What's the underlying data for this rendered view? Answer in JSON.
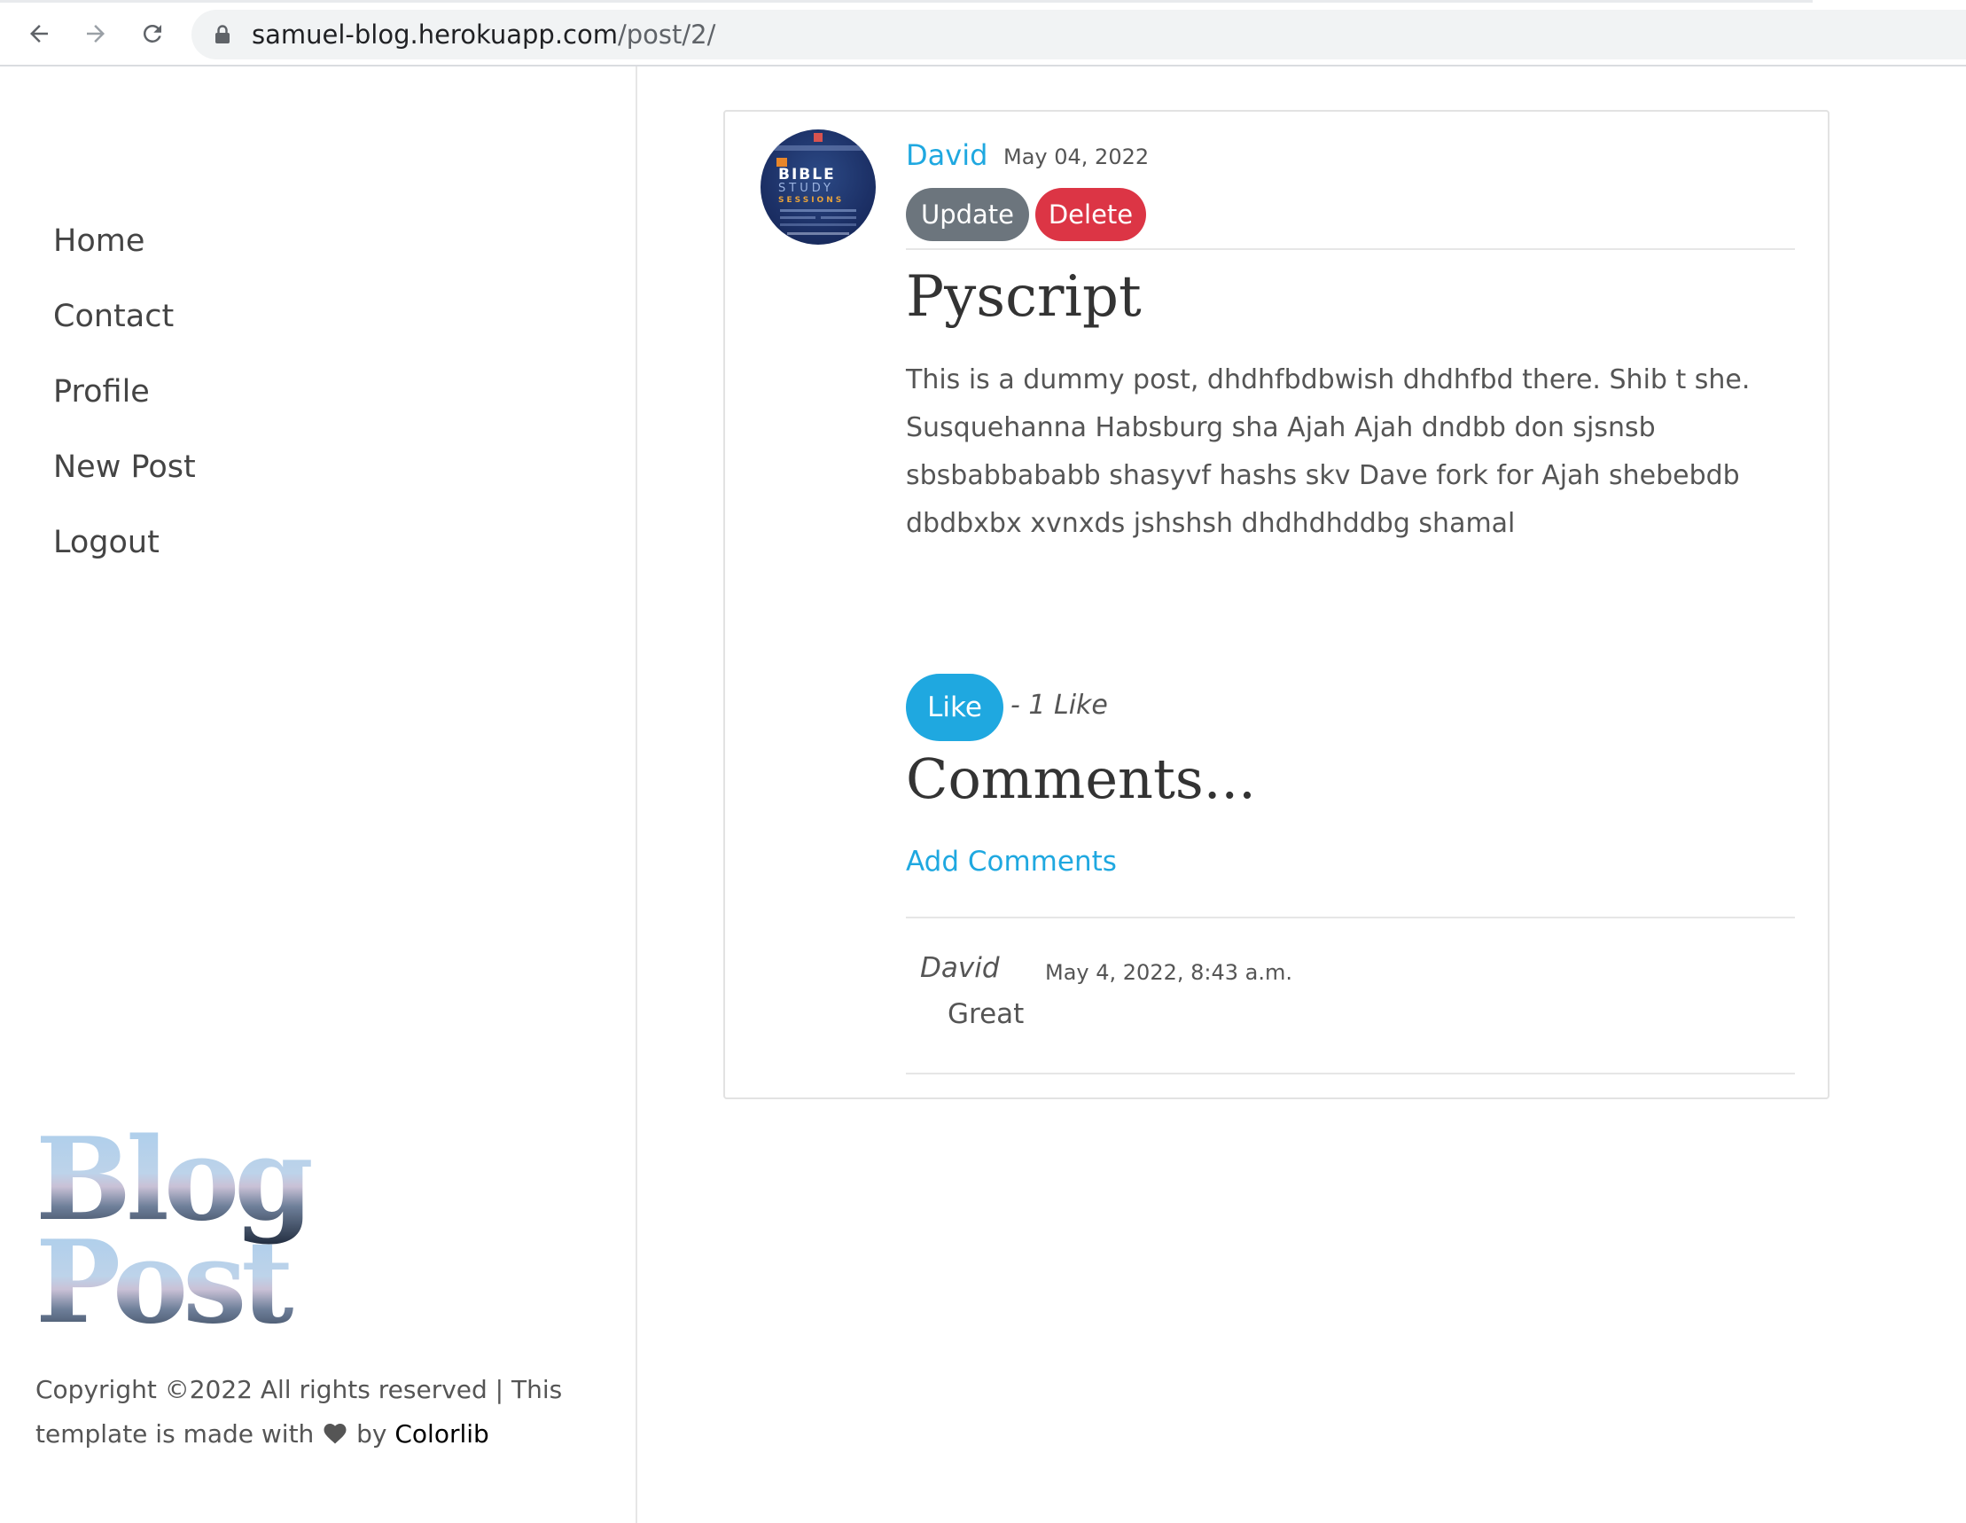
{
  "browser": {
    "url_host": "samuel-blog.herokuapp.com",
    "url_path": "/post/2/"
  },
  "sidebar": {
    "nav": [
      {
        "label": "Home"
      },
      {
        "label": "Contact"
      },
      {
        "label": "Profile"
      },
      {
        "label": "New Post"
      },
      {
        "label": "Logout"
      }
    ],
    "logo_line1": "Blog",
    "logo_line2": "Post",
    "copyright_text": "Copyright ©2022 All rights reserved | This template is made with",
    "copyright_by": "by",
    "copyright_link": "Colorlib"
  },
  "post": {
    "author": "David",
    "date": "May 04, 2022",
    "update_label": "Update",
    "delete_label": "Delete",
    "title": "Pyscript",
    "body": "This is a dummy post, dhdhfbdbwish dhdhfbd there. Shib t she. Susquehanna Habsburg sha Ajah Ajah dndbb don sjsnsb sbsbabbababb shasyvf hashs skv Dave fork for Ajah shebebdb dbdbxbx xvnxds jshshsh dhdhdhddbg shamal",
    "like_label": "Like",
    "like_count": "- 1 Like",
    "comments_heading": "Comments...",
    "add_comments_label": "Add Comments",
    "avatar_text": [
      "BIBLE",
      "STUDY",
      "SESSIONS"
    ]
  },
  "comments": [
    {
      "author": "David",
      "date": "May 4, 2022, 8:43 a.m.",
      "body": "Great"
    }
  ]
}
